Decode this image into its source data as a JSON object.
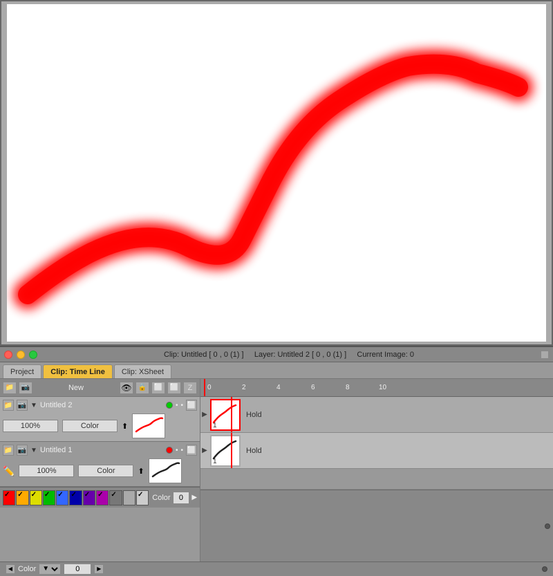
{
  "canvas": {
    "background": "white"
  },
  "title_bar": {
    "clip_info": "Clip: Untitled [ 0 , 0 (1) ]",
    "layer_info": "Layer: Untitled 2 [ 0 , 0 (1) ]",
    "current_image": "Current Image: 0"
  },
  "tabs": [
    {
      "label": "Project",
      "active": false
    },
    {
      "label": "Clip: Time Line",
      "active": true
    },
    {
      "label": "Clip: XSheet",
      "active": false
    }
  ],
  "toolbar": {
    "new_label": "New"
  },
  "layers": [
    {
      "name": "Untitled 2",
      "opacity": "100%",
      "color_label": "Color",
      "color_dot": "#00cc00",
      "has_pencil": false
    },
    {
      "name": "Untitled 1",
      "opacity": "100%",
      "color_label": "Color",
      "color_dot": "#ff0000",
      "has_pencil": true
    }
  ],
  "swatches": [
    {
      "color": "#ff0000",
      "checked": true
    },
    {
      "color": "#ffaa00",
      "checked": true
    },
    {
      "color": "#ffff00",
      "checked": true
    },
    {
      "color": "#00cc00",
      "checked": true
    },
    {
      "color": "#0000ff",
      "checked": true
    },
    {
      "color": "#0000aa",
      "checked": true
    },
    {
      "color": "#8800aa",
      "checked": true
    },
    {
      "color": "#aa00aa",
      "checked": true
    },
    {
      "color": "#888888",
      "checked": true
    },
    {
      "color": "#aaaaaa",
      "checked": false
    },
    {
      "color": "#cccccc",
      "checked": true
    }
  ],
  "color_section": {
    "label": "Color",
    "value": "0"
  },
  "timeline": {
    "frame_numbers": [
      "0",
      "2",
      "4",
      "6",
      "8",
      "10"
    ],
    "hold_label": "Hold",
    "frame_label": "1"
  }
}
